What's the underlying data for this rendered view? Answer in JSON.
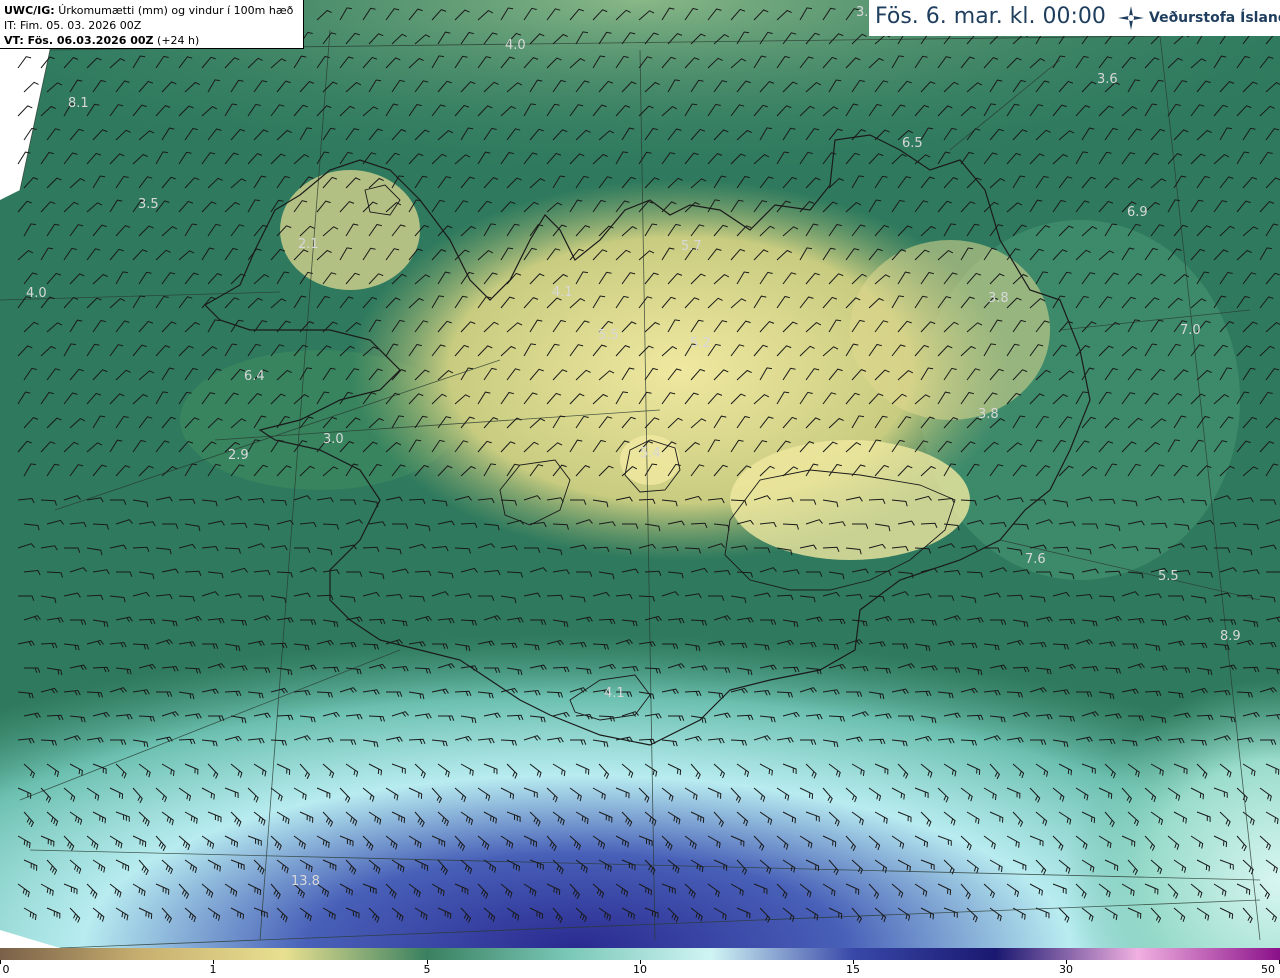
{
  "header": {
    "line1_bold": "UWC/IG:",
    "line1_rest": "Úrkomumætti (mm) og vindur í 100m hæð",
    "line2": "IT: Fim. 05. 03. 2026 00Z",
    "line3_bold": "VT: Fös. 06.03.2026 00Z",
    "line3_rest": "(+24 h)"
  },
  "title": {
    "text": "Fös. 6. mar. kl. 00:00",
    "logo_text": "Veðurstofa Íslands",
    "logo_icon": "vedurstofa-logo-icon"
  },
  "colorbar": {
    "ticks": [
      "0",
      "1",
      "5",
      "10",
      "15",
      "30",
      "50"
    ],
    "colors": [
      "#7a6048",
      "#c8b070",
      "#e8e090",
      "#3a8060",
      "#7ac8b8",
      "#d0f4f4",
      "#3848a8",
      "#1a1870",
      "#f0b0e0",
      "#8a1088"
    ]
  },
  "map": {
    "value_labels": [
      "3.",
      "4.0",
      "3.6",
      "8.1",
      "6.5",
      "3.5",
      "6.9",
      "2.1",
      "5.7",
      "4.0",
      "4.1",
      "3.8",
      "5.5",
      "5.2",
      "7.0",
      "3.8",
      "6.4",
      "3.0",
      "2.9",
      "5.4",
      "7.6",
      "5.5",
      "8.9",
      "4.1",
      "13.8"
    ],
    "colors": {
      "land_low": "#e8e090",
      "sea": "#2e7a60",
      "outline": "#1a1a1a"
    }
  }
}
